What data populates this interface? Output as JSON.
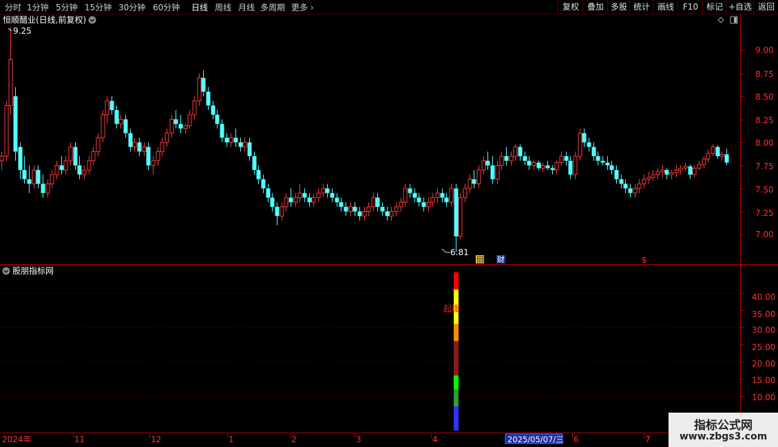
{
  "toolbar": {
    "periods": [
      "分时",
      "1分钟",
      "5分钟",
      "15分钟",
      "30分钟",
      "60分钟",
      "日线",
      "周线",
      "月线",
      "多周期",
      "更多"
    ],
    "active_period": "日线",
    "right_buttons": [
      "复权",
      "叠加",
      "多股",
      "统计",
      "画线",
      "F10",
      "标记",
      "+自选",
      "返回"
    ]
  },
  "main_panel": {
    "title": "恒顺醋业(日线,前复权)",
    "high_label": "9.25",
    "low_label": "6.81",
    "price_axis": [
      "9.00",
      "8.75",
      "8.50",
      "8.25",
      "8.00",
      "7.75",
      "7.50",
      "7.25",
      "7.00"
    ],
    "markers": [
      "回",
      "财",
      "$"
    ]
  },
  "sub_panel": {
    "title": "股朋指标网",
    "annotation": "起爆",
    "value_axis": [
      "40.00",
      "35.00",
      "30.00",
      "25.00",
      "20.00",
      "15.00",
      "10.00"
    ]
  },
  "date_axis": {
    "labels": [
      "2024年",
      "11",
      "12",
      "1",
      "2",
      "3",
      "4",
      "6",
      "7"
    ],
    "cursor_date": "2025/05/07/三"
  },
  "watermark": {
    "title": "指标公式网",
    "url": "www.zbgs3.com"
  },
  "colors": {
    "up": "#ff3b3b",
    "down": "#54ffff",
    "frame": "#b00000",
    "background": "#000000"
  },
  "chart_data": {
    "type": "candlestick",
    "price_range": [
      6.8,
      9.3
    ],
    "candles": [
      [
        7.8,
        7.9,
        7.7,
        7.85
      ],
      [
        7.85,
        8.45,
        7.8,
        8.4
      ],
      [
        8.4,
        9.25,
        8.3,
        8.9
      ],
      [
        8.5,
        8.6,
        7.8,
        7.9
      ],
      [
        7.95,
        8.0,
        7.6,
        7.7
      ],
      [
        7.7,
        7.85,
        7.55,
        7.6
      ],
      [
        7.6,
        7.75,
        7.45,
        7.55
      ],
      [
        7.55,
        7.75,
        7.5,
        7.7
      ],
      [
        7.7,
        7.75,
        7.5,
        7.55
      ],
      [
        7.55,
        7.65,
        7.4,
        7.45
      ],
      [
        7.45,
        7.6,
        7.4,
        7.55
      ],
      [
        7.55,
        7.7,
        7.5,
        7.65
      ],
      [
        7.65,
        7.8,
        7.6,
        7.75
      ],
      [
        7.75,
        7.85,
        7.65,
        7.7
      ],
      [
        7.7,
        7.85,
        7.65,
        7.8
      ],
      [
        7.8,
        8.0,
        7.75,
        7.95
      ],
      [
        7.95,
        8.0,
        7.7,
        7.75
      ],
      [
        7.75,
        7.85,
        7.6,
        7.65
      ],
      [
        7.65,
        7.75,
        7.6,
        7.7
      ],
      [
        7.7,
        7.85,
        7.65,
        7.8
      ],
      [
        7.8,
        7.95,
        7.75,
        7.9
      ],
      [
        7.9,
        8.1,
        7.85,
        8.05
      ],
      [
        8.05,
        8.35,
        8.0,
        8.3
      ],
      [
        8.3,
        8.5,
        8.2,
        8.45
      ],
      [
        8.45,
        8.5,
        8.3,
        8.35
      ],
      [
        8.35,
        8.4,
        8.15,
        8.2
      ],
      [
        8.2,
        8.3,
        8.15,
        8.25
      ],
      [
        8.25,
        8.3,
        8.05,
        8.1
      ],
      [
        8.1,
        8.15,
        7.9,
        7.95
      ],
      [
        7.95,
        8.05,
        7.9,
        8.0
      ],
      [
        8.0,
        8.05,
        7.85,
        7.9
      ],
      [
        7.9,
        8.0,
        7.85,
        7.95
      ],
      [
        7.95,
        8.0,
        7.7,
        7.75
      ],
      [
        7.75,
        7.85,
        7.65,
        7.8
      ],
      [
        7.8,
        7.95,
        7.75,
        7.9
      ],
      [
        7.9,
        8.05,
        7.85,
        8.0
      ],
      [
        8.0,
        8.15,
        7.95,
        8.1
      ],
      [
        8.1,
        8.3,
        8.05,
        8.25
      ],
      [
        8.25,
        8.35,
        8.15,
        8.2
      ],
      [
        8.2,
        8.3,
        8.1,
        8.15
      ],
      [
        8.15,
        8.2,
        8.1,
        8.18
      ],
      [
        8.18,
        8.35,
        8.15,
        8.3
      ],
      [
        8.3,
        8.5,
        8.25,
        8.45
      ],
      [
        8.45,
        8.75,
        8.4,
        8.7
      ],
      [
        8.7,
        8.78,
        8.5,
        8.55
      ],
      [
        8.55,
        8.6,
        8.35,
        8.4
      ],
      [
        8.4,
        8.45,
        8.25,
        8.3
      ],
      [
        8.3,
        8.35,
        8.15,
        8.2
      ],
      [
        8.2,
        8.25,
        8.0,
        8.05
      ],
      [
        8.05,
        8.1,
        7.95,
        8.0
      ],
      [
        8.0,
        8.1,
        7.95,
        8.05
      ],
      [
        8.05,
        8.15,
        7.95,
        8.0
      ],
      [
        8.0,
        8.05,
        7.9,
        7.95
      ],
      [
        7.95,
        8.05,
        7.9,
        8.0
      ],
      [
        8.0,
        8.05,
        7.8,
        7.85
      ],
      [
        7.85,
        7.9,
        7.65,
        7.7
      ],
      [
        7.7,
        7.75,
        7.55,
        7.6
      ],
      [
        7.6,
        7.65,
        7.45,
        7.5
      ],
      [
        7.5,
        7.55,
        7.35,
        7.4
      ],
      [
        7.4,
        7.45,
        7.25,
        7.3
      ],
      [
        7.3,
        7.35,
        7.1,
        7.2
      ],
      [
        7.2,
        7.35,
        7.15,
        7.3
      ],
      [
        7.3,
        7.45,
        7.25,
        7.4
      ],
      [
        7.4,
        7.5,
        7.3,
        7.35
      ],
      [
        7.35,
        7.45,
        7.3,
        7.4
      ],
      [
        7.4,
        7.55,
        7.35,
        7.45
      ],
      [
        7.45,
        7.5,
        7.35,
        7.4
      ],
      [
        7.4,
        7.45,
        7.3,
        7.35
      ],
      [
        7.35,
        7.45,
        7.3,
        7.4
      ],
      [
        7.4,
        7.5,
        7.35,
        7.45
      ],
      [
        7.45,
        7.55,
        7.4,
        7.5
      ],
      [
        7.5,
        7.55,
        7.4,
        7.45
      ],
      [
        7.45,
        7.5,
        7.35,
        7.4
      ],
      [
        7.4,
        7.45,
        7.3,
        7.35
      ],
      [
        7.35,
        7.4,
        7.25,
        7.3
      ],
      [
        7.3,
        7.35,
        7.2,
        7.25
      ],
      [
        7.25,
        7.35,
        7.2,
        7.3
      ],
      [
        7.3,
        7.35,
        7.2,
        7.25
      ],
      [
        7.25,
        7.3,
        7.15,
        7.2
      ],
      [
        7.2,
        7.3,
        7.15,
        7.25
      ],
      [
        7.25,
        7.35,
        7.2,
        7.3
      ],
      [
        7.3,
        7.45,
        7.25,
        7.4
      ],
      [
        7.4,
        7.45,
        7.25,
        7.3
      ],
      [
        7.3,
        7.35,
        7.2,
        7.25
      ],
      [
        7.25,
        7.3,
        7.15,
        7.2
      ],
      [
        7.2,
        7.3,
        7.15,
        7.25
      ],
      [
        7.25,
        7.35,
        7.2,
        7.3
      ],
      [
        7.3,
        7.4,
        7.25,
        7.35
      ],
      [
        7.35,
        7.55,
        7.3,
        7.5
      ],
      [
        7.5,
        7.55,
        7.4,
        7.45
      ],
      [
        7.45,
        7.5,
        7.35,
        7.4
      ],
      [
        7.4,
        7.45,
        7.3,
        7.35
      ],
      [
        7.35,
        7.4,
        7.25,
        7.3
      ],
      [
        7.3,
        7.4,
        7.25,
        7.35
      ],
      [
        7.35,
        7.45,
        7.3,
        7.4
      ],
      [
        7.4,
        7.5,
        7.35,
        7.45
      ],
      [
        7.45,
        7.5,
        7.35,
        7.4
      ],
      [
        7.4,
        7.45,
        7.3,
        7.35
      ],
      [
        7.35,
        7.55,
        7.3,
        7.5
      ],
      [
        7.5,
        7.55,
        6.81,
        6.98
      ],
      [
        6.98,
        7.45,
        6.95,
        7.4
      ],
      [
        7.4,
        7.55,
        7.35,
        7.5
      ],
      [
        7.5,
        7.65,
        7.45,
        7.6
      ],
      [
        7.6,
        7.7,
        7.5,
        7.55
      ],
      [
        7.55,
        7.75,
        7.5,
        7.7
      ],
      [
        7.7,
        7.85,
        7.65,
        7.8
      ],
      [
        7.8,
        7.9,
        7.7,
        7.75
      ],
      [
        7.75,
        7.85,
        7.55,
        7.6
      ],
      [
        7.6,
        7.8,
        7.55,
        7.75
      ],
      [
        7.75,
        7.9,
        7.7,
        7.85
      ],
      [
        7.85,
        7.95,
        7.75,
        7.8
      ],
      [
        7.8,
        7.9,
        7.75,
        7.85
      ],
      [
        7.85,
        7.98,
        7.8,
        7.95
      ],
      [
        7.95,
        7.98,
        7.8,
        7.85
      ],
      [
        7.85,
        7.9,
        7.75,
        7.8
      ],
      [
        7.8,
        7.85,
        7.7,
        7.75
      ],
      [
        7.75,
        7.8,
        7.7,
        7.78
      ],
      [
        7.78,
        7.8,
        7.7,
        7.72
      ],
      [
        7.72,
        7.78,
        7.68,
        7.75
      ],
      [
        7.75,
        7.8,
        7.7,
        7.72
      ],
      [
        7.72,
        7.75,
        7.65,
        7.7
      ],
      [
        7.7,
        7.8,
        7.65,
        7.78
      ],
      [
        7.78,
        7.9,
        7.75,
        7.85
      ],
      [
        7.85,
        7.9,
        7.75,
        7.8
      ],
      [
        7.8,
        7.85,
        7.6,
        7.65
      ],
      [
        7.65,
        7.9,
        7.6,
        7.85
      ],
      [
        7.85,
        8.15,
        7.8,
        8.1
      ],
      [
        8.1,
        8.15,
        7.95,
        8.0
      ],
      [
        8.0,
        8.05,
        7.9,
        7.95
      ],
      [
        7.95,
        8.0,
        7.8,
        7.85
      ],
      [
        7.85,
        7.9,
        7.75,
        7.8
      ],
      [
        7.8,
        7.85,
        7.75,
        7.78
      ],
      [
        7.78,
        7.85,
        7.7,
        7.75
      ],
      [
        7.75,
        7.8,
        7.65,
        7.7
      ],
      [
        7.7,
        7.75,
        7.55,
        7.6
      ],
      [
        7.6,
        7.65,
        7.5,
        7.55
      ],
      [
        7.55,
        7.6,
        7.45,
        7.5
      ],
      [
        7.5,
        7.55,
        7.4,
        7.45
      ],
      [
        7.45,
        7.55,
        7.4,
        7.5
      ],
      [
        7.5,
        7.6,
        7.45,
        7.55
      ],
      [
        7.55,
        7.65,
        7.5,
        7.6
      ],
      [
        7.6,
        7.68,
        7.55,
        7.62
      ],
      [
        7.62,
        7.7,
        7.58,
        7.65
      ],
      [
        7.65,
        7.72,
        7.6,
        7.68
      ],
      [
        7.68,
        7.75,
        7.62,
        7.7
      ],
      [
        7.7,
        7.72,
        7.6,
        7.65
      ],
      [
        7.65,
        7.7,
        7.6,
        7.67
      ],
      [
        7.67,
        7.75,
        7.62,
        7.7
      ],
      [
        7.7,
        7.75,
        7.65,
        7.72
      ],
      [
        7.72,
        7.78,
        7.68,
        7.74
      ],
      [
        7.74,
        7.76,
        7.6,
        7.65
      ],
      [
        7.65,
        7.75,
        7.62,
        7.72
      ],
      [
        7.72,
        7.8,
        7.7,
        7.76
      ],
      [
        7.76,
        7.85,
        7.72,
        7.82
      ],
      [
        7.82,
        7.92,
        7.78,
        7.88
      ],
      [
        7.88,
        7.98,
        7.85,
        7.95
      ],
      [
        7.95,
        7.97,
        7.82,
        7.85
      ],
      [
        7.85,
        7.9,
        7.8,
        7.87
      ],
      [
        7.87,
        7.93,
        7.75,
        7.78
      ]
    ],
    "indicator": {
      "annotation": "起爆",
      "bar_segments": [
        {
          "from": 0,
          "to": 7,
          "color": "#3030ff"
        },
        {
          "from": 7,
          "to": 12,
          "color": "#2e9b3b"
        },
        {
          "from": 12,
          "to": 16,
          "color": "#00ff00"
        },
        {
          "from": 16,
          "to": 26,
          "color": "#8b1a1a"
        },
        {
          "from": 26,
          "to": 31,
          "color": "#ff8c00"
        },
        {
          "from": 31,
          "to": 41,
          "color": "#ffff00"
        },
        {
          "from": 41,
          "to": 46,
          "color": "#ff0000"
        }
      ],
      "bar_candle_index": 99,
      "ylim": [
        0,
        47
      ]
    }
  }
}
